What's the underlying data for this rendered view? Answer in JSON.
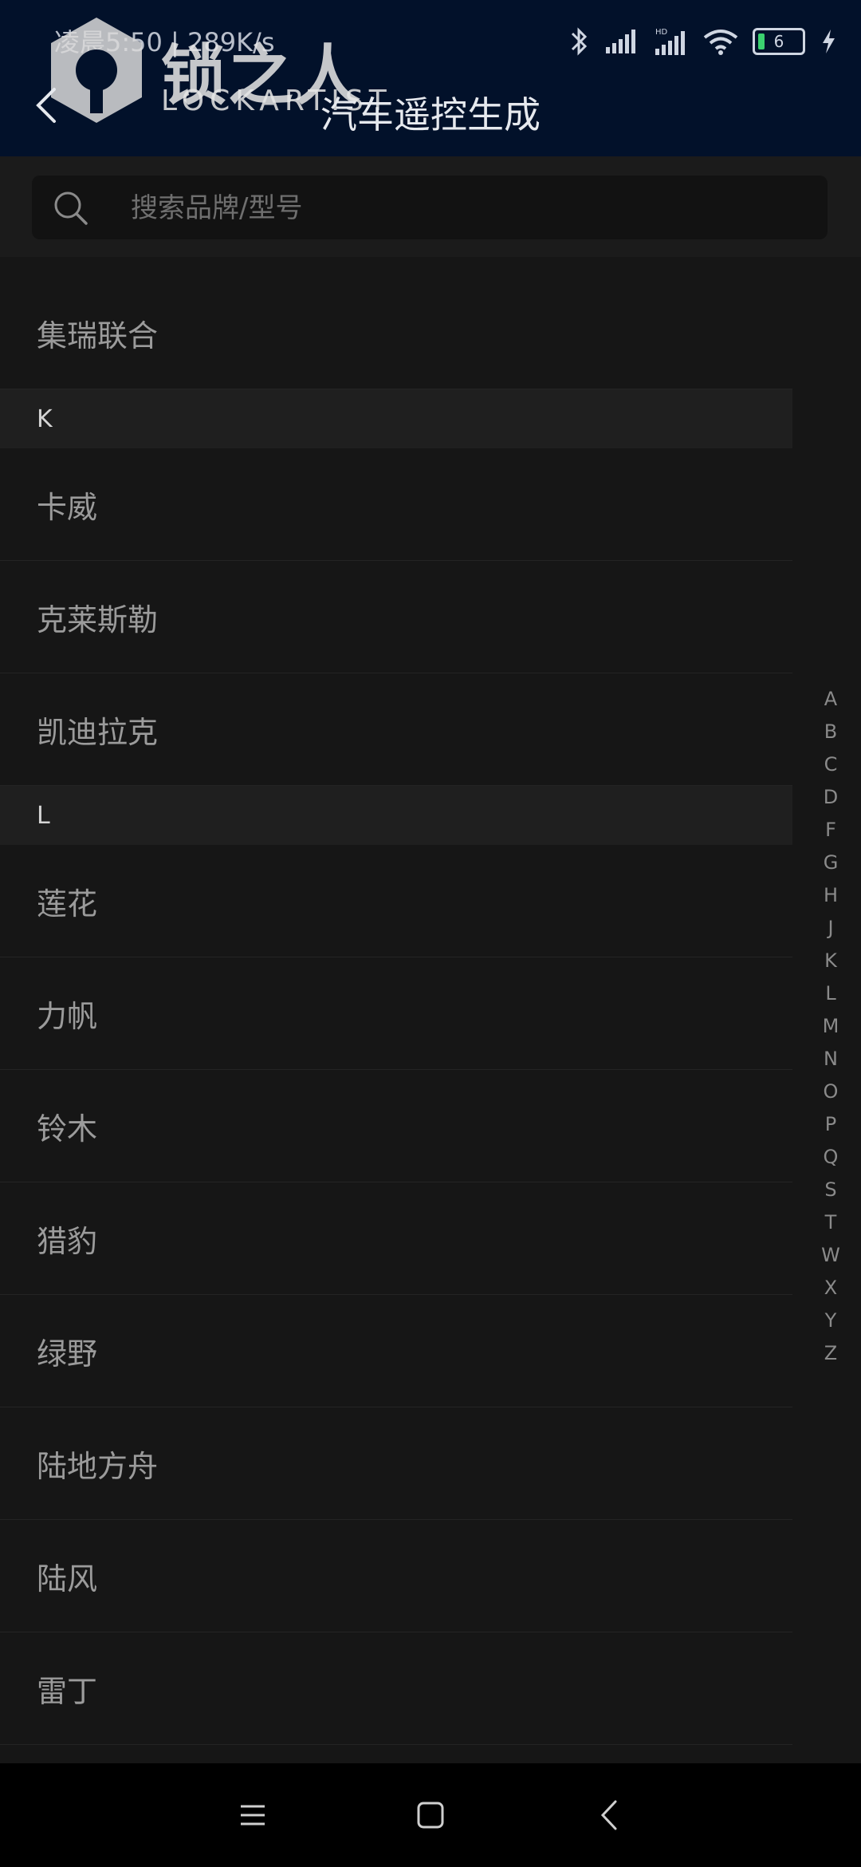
{
  "status_bar": {
    "time_text": "凌晨5:50 | 289K/s",
    "battery_level": "6"
  },
  "watermark": {
    "brand_cn": "锁之人",
    "brand_en": "LOCKARTIST"
  },
  "header": {
    "title": "汽车遥控生成"
  },
  "search": {
    "placeholder": "搜索品牌/型号"
  },
  "list": {
    "first_item": "集瑞联合",
    "sections": [
      {
        "letter": "K",
        "items": [
          "卡威",
          "克莱斯勒",
          "凯迪拉克"
        ]
      },
      {
        "letter": "L",
        "items": [
          "莲花",
          "力帆",
          "铃木",
          "猎豹",
          "绿野",
          "陆地方舟",
          "陆风",
          "雷丁"
        ]
      }
    ]
  },
  "index_bar": {
    "letters": [
      "A",
      "B",
      "C",
      "D",
      "F",
      "G",
      "H",
      "J",
      "K",
      "L",
      "M",
      "N",
      "O",
      "P",
      "Q",
      "S",
      "T",
      "W",
      "X",
      "Y",
      "Z"
    ]
  }
}
